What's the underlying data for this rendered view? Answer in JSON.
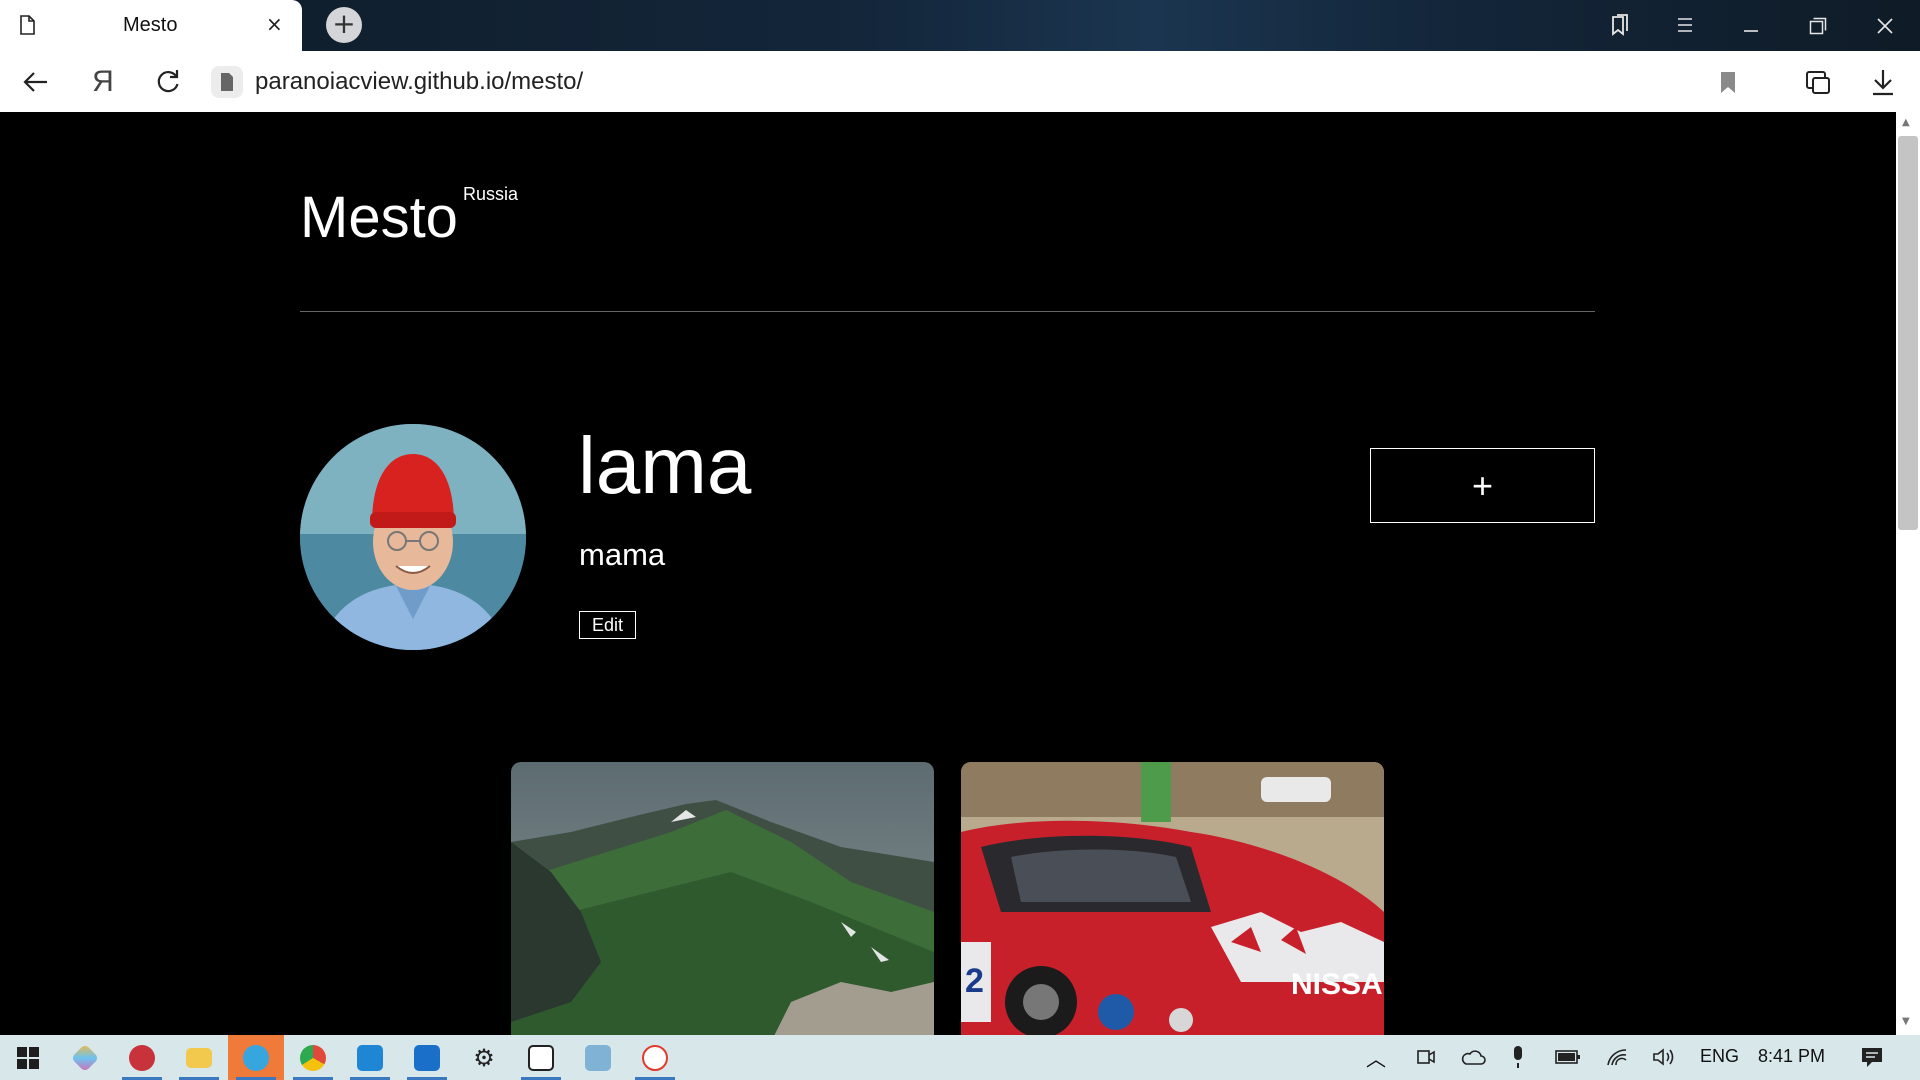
{
  "browser": {
    "tab_title": "Mesto",
    "tab_close": "×",
    "new_tab": "+",
    "url": "paranoiacview.github.io/mesto/",
    "yandex_glyph": "Я",
    "icons": [
      "page-icon",
      "close-icon",
      "plus-icon",
      "bookmarks-icon",
      "menu-icon",
      "minimize-icon",
      "restore-icon",
      "window-close-icon",
      "back-icon",
      "yandex-icon",
      "reload-icon",
      "bookmark-icon",
      "extensions-icon",
      "download-icon"
    ]
  },
  "page": {
    "logo": "Mesto",
    "logo_sup": "Russia",
    "profile": {
      "name": "lama",
      "about": "mama",
      "edit_label": "Edit",
      "add_label": "+"
    },
    "cards": [
      {
        "image": "mountain-landscape"
      },
      {
        "image": "red-nissan-race-car"
      }
    ]
  },
  "taskbar": {
    "apps": [
      "start",
      "paint-app",
      "media-app",
      "file-explorer",
      "telegram",
      "chrome",
      "vscode",
      "outlook-app",
      "settings",
      "solitaire",
      "files-app",
      "yandex-browser"
    ],
    "language": "ENG",
    "time": "8:41 PM"
  },
  "colors": {
    "page_bg": "#000000",
    "taskbar_bg": "#d7e7ea",
    "active_app": "#f07a3a"
  }
}
